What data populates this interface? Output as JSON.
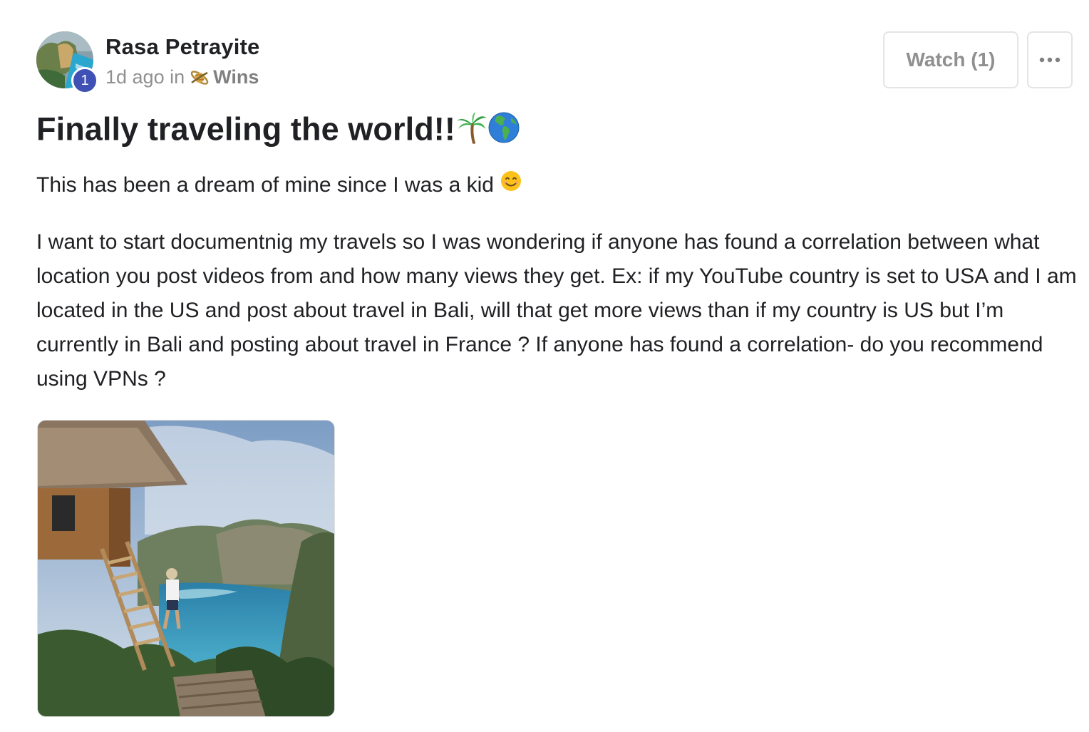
{
  "post": {
    "author": {
      "name": "Rasa Petrayite",
      "level": "1",
      "avatar_icon": "avatar-photo"
    },
    "meta": {
      "time": "1d ago in",
      "category": "Wins",
      "category_icon": "saturn-planet-icon"
    },
    "actions": {
      "watch_label": "Watch (1)",
      "more_icon": "ellipsis-icon"
    },
    "title": "Finally traveling the world!!",
    "title_emojis": [
      "palm-tree-icon",
      "globe-americas-icon"
    ],
    "body": {
      "paragraph1": "This has been a dream of mine since I was a kid",
      "paragraph1_emoji": "smiling-face-icon",
      "paragraph2": "I want to start documentnig my travels so I was wondering if anyone has found a correlation between what location you post videos from and how many views they get. Ex: if my YouTube country is set to USA and I am located in the US and post about travel in Bali, will that get more views than if my country is US but I’m currently in Bali and posting about travel in France ? If anyone has found a correlation- do you recommend using VPNs ?"
    },
    "attachment": {
      "icon": "attachment-image"
    }
  },
  "colors": {
    "level_badge": "#3f51b5",
    "text_primary": "#202124",
    "text_muted": "#909090",
    "border": "#e4e4e4"
  }
}
